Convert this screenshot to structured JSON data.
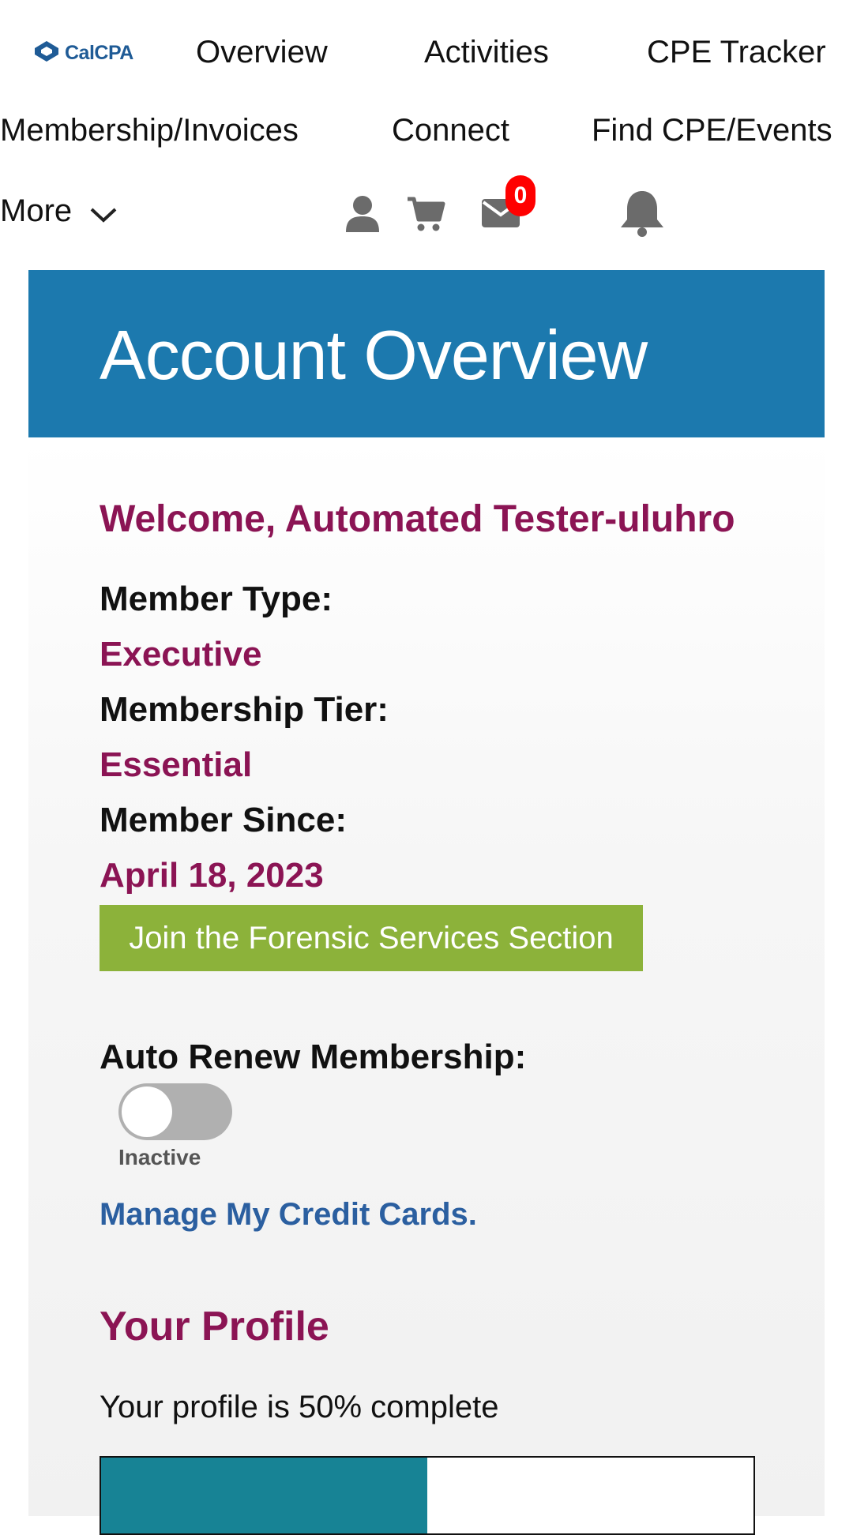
{
  "nav": {
    "logo_text": "CalCPA",
    "links": [
      "Overview",
      "Activities",
      "CPE Tracker",
      "Membership/Invoices",
      "Connect",
      "Find CPE/Events"
    ],
    "more_label": "More",
    "icons": [
      "user-icon",
      "cart-icon",
      "mail-icon",
      "bell-icon"
    ],
    "mail_badge": "0"
  },
  "banner": {
    "title": "Account Overview",
    "color": "#1c79ae"
  },
  "account": {
    "welcome": "Welcome, Automated Tester-uluhro",
    "member_type_label": "Member Type:",
    "member_type_value": "Executive",
    "tier_label": "Membership Tier:",
    "tier_value": "Essential",
    "since_label": "Member Since:",
    "since_value": "April 18, 2023",
    "join_button": "Join the Forensic Services Section",
    "auto_renew_label": "Auto Renew Membership:",
    "auto_renew_on": false,
    "auto_renew_state": "Inactive",
    "credit_cards_link": "Manage My Credit Cards."
  },
  "profile": {
    "heading": "Your Profile",
    "completion_text": "Your profile is 50% complete",
    "completion_fraction": 0.5
  },
  "colors": {
    "accent": "#8b1454",
    "button": "#8cb23a",
    "link": "#2b5fa0",
    "progress": "#178395",
    "badge": "#ff0000"
  }
}
